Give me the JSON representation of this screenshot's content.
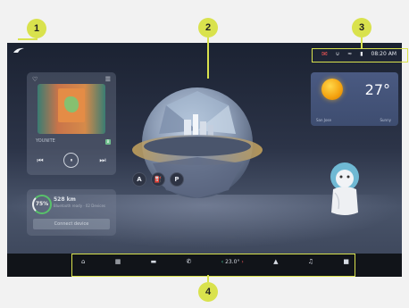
{
  "status_bar": {
    "time": "08:20 AM",
    "icons": [
      "message-icon",
      "bluetooth-icon",
      "wifi-icon",
      "signal-icon"
    ]
  },
  "media": {
    "song_title": "YOUNITE",
    "source_badge": "B",
    "controls": {
      "prev": "⏮",
      "pause": "⏸",
      "next": "⏭"
    }
  },
  "device": {
    "battery_percent": "75%",
    "range": "528 km",
    "subtitle": "Bluetooth ready · 02 Devices",
    "connect_button": "Connect device"
  },
  "navigation_chips": [
    "A",
    "⛽",
    "P"
  ],
  "weather": {
    "temperature": "27°",
    "location": "San Jose",
    "condition": "Sunny"
  },
  "taskbar": {
    "items": [
      "home-icon",
      "apps-icon",
      "car-icon",
      "phone-icon",
      "climate",
      "bluetooth-icon",
      "music-icon",
      "volume-icon"
    ],
    "temperature": "23.0°"
  },
  "annotations": [
    "1",
    "2",
    "3",
    "4"
  ],
  "colors": {
    "annotation": "#d9e24d",
    "taskbar": "#111419",
    "battery_ring": "#58c26a"
  }
}
